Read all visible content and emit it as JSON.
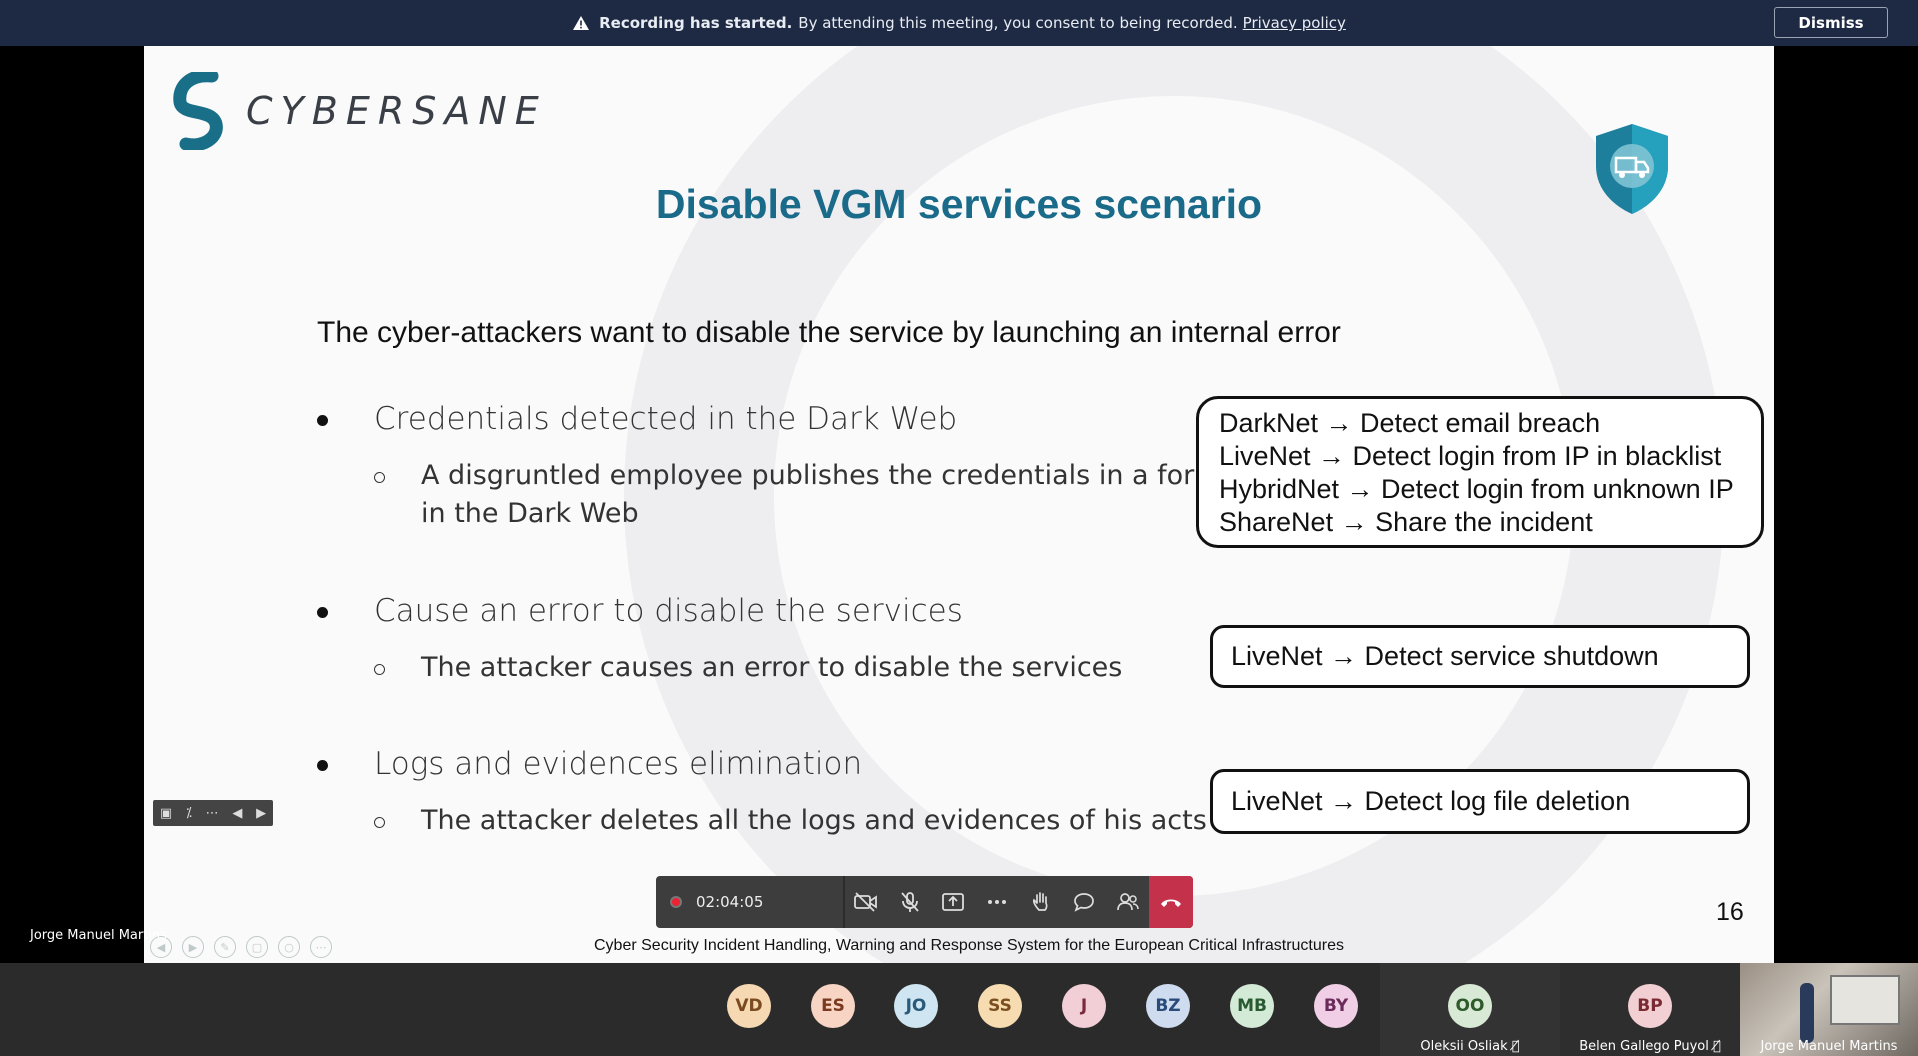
{
  "banner": {
    "bold": "Recording has started.",
    "message": "By attending this meeting, you consent to being recorded.",
    "link": "Privacy policy",
    "dismiss": "Dismiss"
  },
  "slide": {
    "logo": "CYBERSANE",
    "title": "Disable VGM services scenario",
    "intro": "The cyber-attackers want to disable the service by launching an internal error",
    "bullets": [
      {
        "text": "Credentials detected in the Dark Web",
        "sub": [
          "A disgruntled employee publishes the credentials in a forum",
          "in the Dark Web"
        ]
      },
      {
        "text": "Cause an error to disable the services",
        "sub": [
          "The attacker causes an error to disable the services"
        ]
      },
      {
        "text": "Logs and evidences elimination",
        "sub": [
          "The attacker deletes all the logs and evidences of his acts"
        ]
      }
    ],
    "boxes": [
      [
        "DarkNet → Detect email breach",
        "LiveNet → Detect login from IP in blacklist",
        "HybridNet → Detect login from unknown IP",
        "ShareNet → Share the incident"
      ],
      [
        "LiveNet → Detect service shutdown"
      ],
      [
        "LiveNet → Detect log file deletion"
      ]
    ],
    "page_number": "16",
    "footer": "Cyber Security Incident Handling, Warning and Response System for the European Critical Infrastructures"
  },
  "controls": {
    "timer": "02:04:05"
  },
  "presenter_name": "Jorge Manuel Martins",
  "participants": [
    {
      "initials": "VD",
      "bg": "#f6d8b2",
      "fg": "#7a4a20"
    },
    {
      "initials": "ES",
      "bg": "#f7d4c4",
      "fg": "#7a3a20"
    },
    {
      "initials": "JO",
      "bg": "#cfe6f2",
      "fg": "#2a5a7a"
    },
    {
      "initials": "SS",
      "bg": "#f6dcb0",
      "fg": "#7a5020"
    },
    {
      "initials": "J",
      "bg": "#f2cfd6",
      "fg": "#7a2a3a"
    },
    {
      "initials": "BZ",
      "bg": "#cfdcf0",
      "fg": "#2a4a7a"
    },
    {
      "initials": "MB",
      "bg": "#d3ead6",
      "fg": "#2a5a32"
    },
    {
      "initials": "BY",
      "bg": "#f0cfe6",
      "fg": "#6a2a5a"
    }
  ],
  "named_tiles": [
    {
      "initials": "OO",
      "name": "Oleksii Osliak",
      "bg": "#d8e9d6",
      "fg": "#2f5a2c"
    },
    {
      "initials": "BP",
      "name": "Belen Gallego Puyol",
      "bg": "#f1cfd2",
      "fg": "#7a2a32"
    }
  ],
  "video_tile_name": "Jorge Manuel Martins"
}
